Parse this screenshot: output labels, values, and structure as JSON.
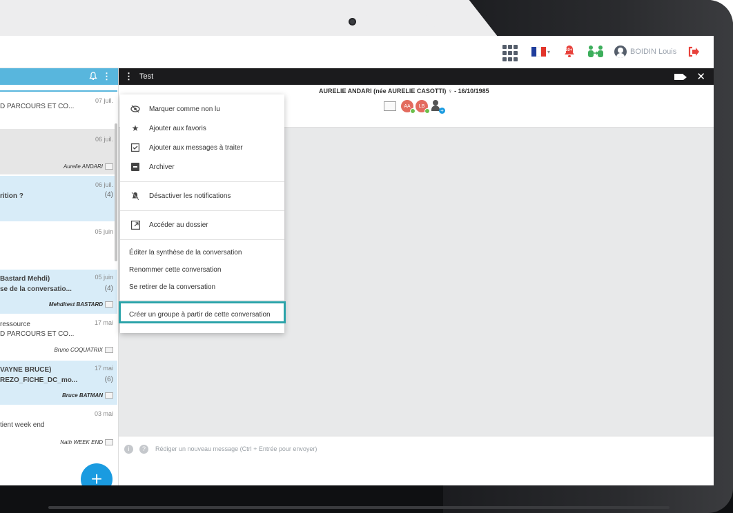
{
  "topbar": {
    "user_name": "BOIDIN Louis",
    "bell_badge": "10+",
    "icons": [
      "apps-grid-icon",
      "french-flag-icon",
      "bell-icon",
      "people-exchange-icon",
      "user-avatar-icon",
      "logout-icon"
    ]
  },
  "colors": {
    "accent_blue": "#58b6dd",
    "selected_row": "#d8ecf8",
    "header_dark": "#1b1b1d",
    "highlight_teal": "#2ba3a9",
    "fab_blue": "#1a9be0",
    "logout_red": "#e8413b"
  },
  "left_panel": {
    "conversations": [
      {
        "date": "07 juil.",
        "line1": "",
        "line2": "D PARCOURS ET CO...",
        "sender": "",
        "count": ""
      },
      {
        "date": "06 juil.",
        "line1": "",
        "line2": "",
        "sender": "Aurelie ANDARI",
        "count": ""
      },
      {
        "date": "06 juil.",
        "line1": "rition ?",
        "line2": "",
        "sender": "",
        "count": "(4)"
      },
      {
        "date": "05 juin",
        "line1": "",
        "line2": "",
        "sender": "",
        "count": ""
      },
      {
        "date": "05 juin",
        "line1": "Bastard Mehdi)",
        "line2": "se de la conversatio...",
        "sender": "Mehditest BASTARD",
        "count": "(4)"
      },
      {
        "date": "17 mai",
        "line1": "ressource",
        "line2": "D PARCOURS ET CO...",
        "sender": "Bruno COQUATRIX",
        "count": ""
      },
      {
        "date": "17 mai",
        "line1": "VAYNE BRUCE)",
        "line2": "REZO_FICHE_DC_mo...",
        "sender": "Bruce BATMAN",
        "count": "(6)"
      },
      {
        "date": "03 mai",
        "line1": "tient week end",
        "line2": "",
        "sender": "Nath WEEK END",
        "count": ""
      }
    ],
    "fab_label": "+"
  },
  "chat": {
    "title": "Test",
    "patient_header": "AURELIE ANDARI (née AURELIE CASOTTI) ♀ - 16/10/1985",
    "participants": [
      "AA",
      "LB"
    ],
    "composer_placeholder": "Rédiger un nouveau message (Ctrl + Entrée pour envoyer)"
  },
  "context_menu": {
    "items": [
      {
        "label": "Marquer comme non lu",
        "icon": "eye-slash-icon"
      },
      {
        "label": "Ajouter aux favoris",
        "icon": "star-icon"
      },
      {
        "label": "Ajouter aux messages à traiter",
        "icon": "checkbox-icon"
      },
      {
        "label": "Archiver",
        "icon": "archive-icon"
      },
      {
        "label": "Désactiver les notifications",
        "icon": "bell-off-icon"
      },
      {
        "label": "Accéder au dossier",
        "icon": "external-link-icon"
      },
      {
        "label": "Éditer la synthèse de la conversation"
      },
      {
        "label": "Renommer cette conversation"
      },
      {
        "label": "Se retirer de la conversation"
      },
      {
        "label": "Créer un groupe à partir de cette conversation"
      }
    ]
  }
}
